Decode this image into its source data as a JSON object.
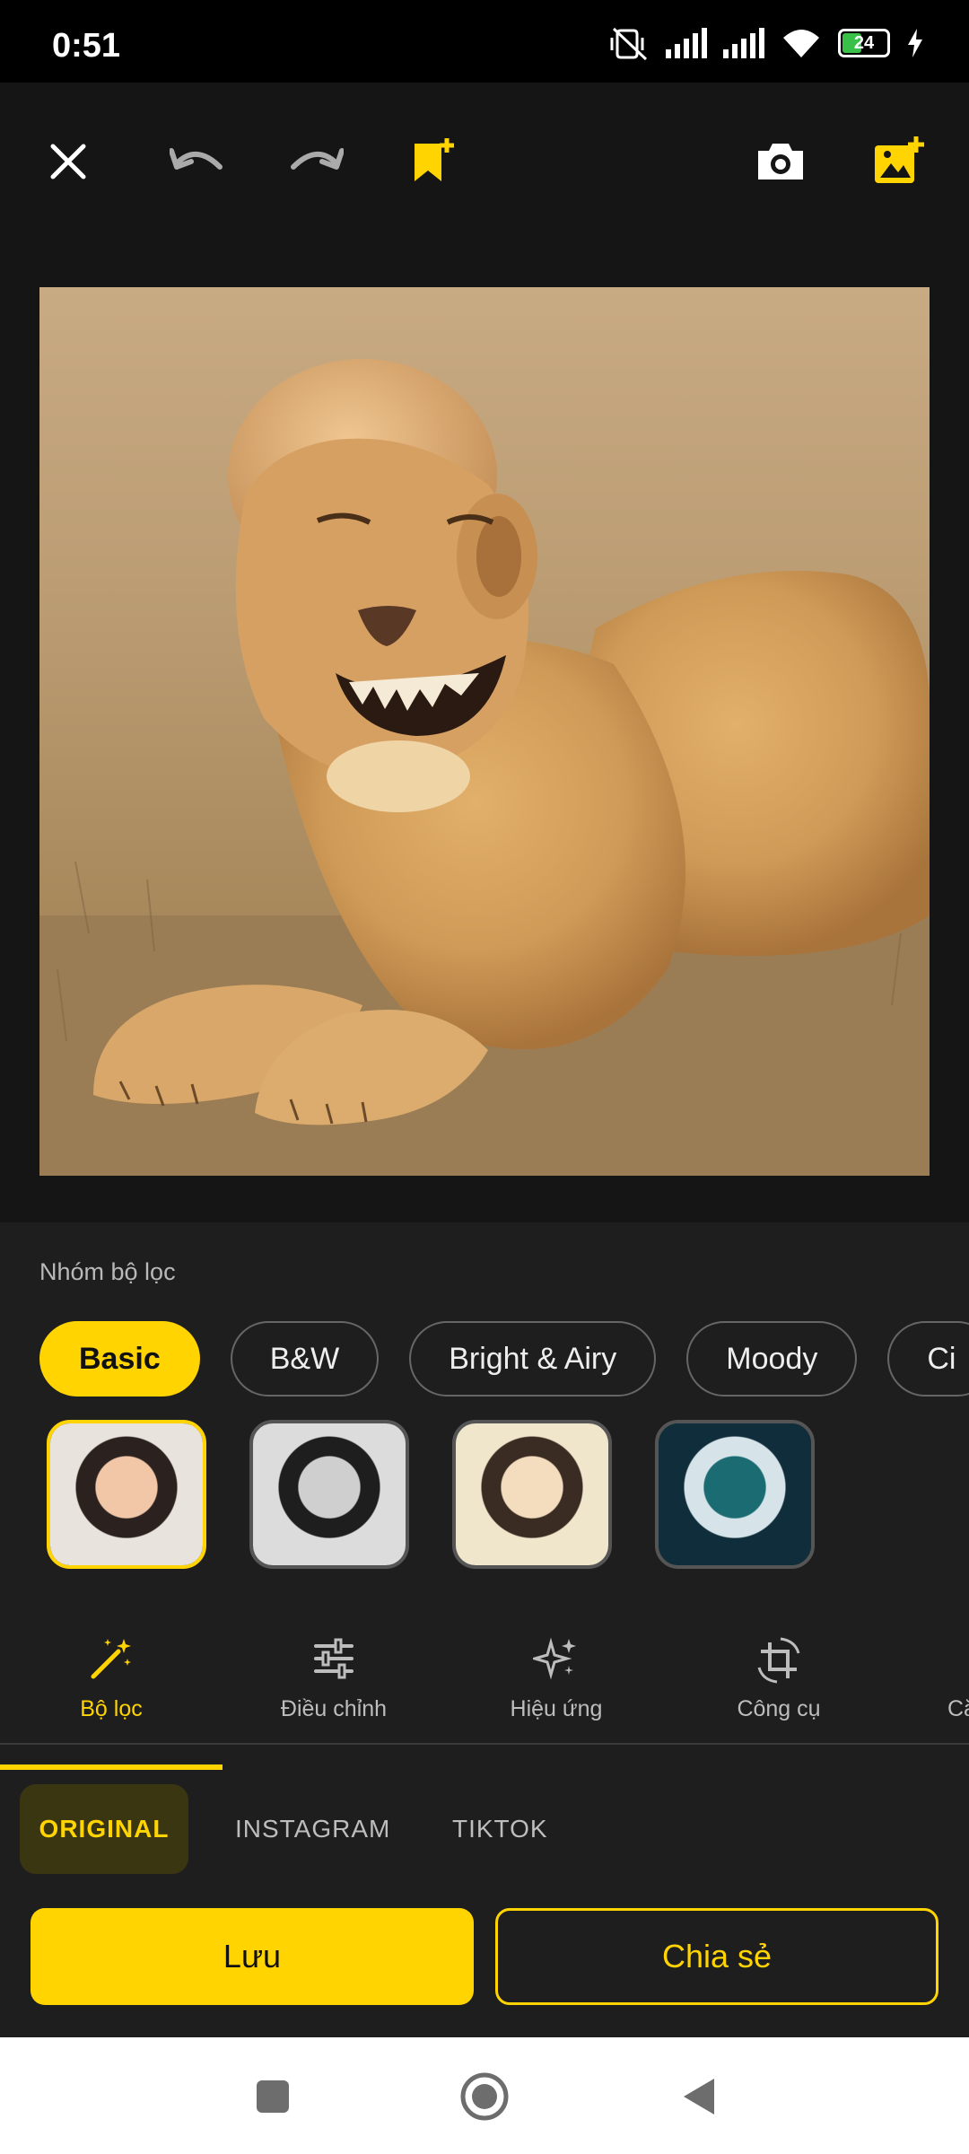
{
  "status": {
    "time": "0:51",
    "battery": "24"
  },
  "filter_group_label": "Nhóm bộ lọc",
  "filter_groups": [
    "Basic",
    "B&W",
    "Bright & Airy",
    "Moody",
    "Ci"
  ],
  "tabs": [
    {
      "label": "Bộ lọc",
      "icon": "magic-wand-icon"
    },
    {
      "label": "Điều chỉnh",
      "icon": "sliders-icon"
    },
    {
      "label": "Hiệu ứng",
      "icon": "sparkles-icon"
    },
    {
      "label": "Công cụ",
      "icon": "crop-rotate-icon"
    },
    {
      "label": "Că",
      "icon": ""
    }
  ],
  "formats": [
    "ORIGINAL",
    "INSTAGRAM",
    "TIKTOK"
  ],
  "actions": {
    "save": "Lưu",
    "share": "Chia sẻ"
  },
  "colors": {
    "accent": "#ffd400",
    "background": "#151515",
    "panel": "#1e1e1e"
  }
}
